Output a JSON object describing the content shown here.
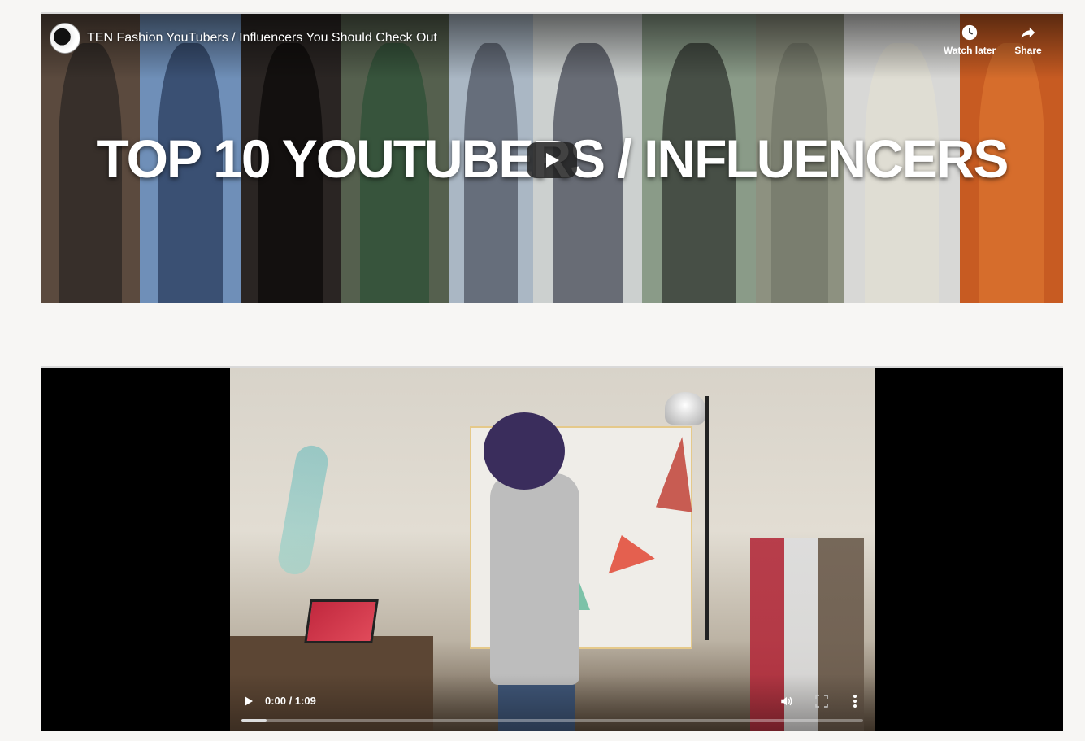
{
  "youtube_embed": {
    "video_title": "TEN Fashion YouTubers / Influencers You Should Check Out",
    "overlay_text": "TOP 10 YOUTUBERS / INFLUENCERS",
    "watch_later_label": "Watch later",
    "share_label": "Share",
    "play_icon": "play-icon",
    "strip_colors": [
      "#5b4a3e",
      "#6f8fb8",
      "#1b1b1b",
      "#55604e",
      "#aab7c4",
      "#1a1d2a",
      "#8a9b88",
      "#8d9180",
      "#d8d8d6",
      "#c75b22"
    ]
  },
  "video_player": {
    "time_display": "0:00 / 1:09",
    "buffered_fraction": 0.04,
    "controls": [
      "play-icon",
      "volume-icon",
      "fullscreen-icon",
      "more-options-icon"
    ]
  }
}
